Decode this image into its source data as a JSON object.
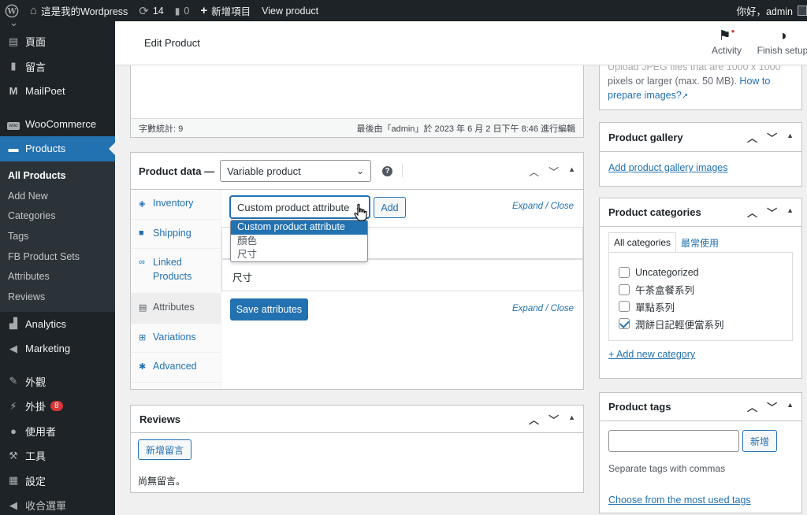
{
  "adminbar": {
    "site_name": "這是我的Wordpress",
    "updates_count": "14",
    "comments_count": "0",
    "new_label": "新增項目",
    "view_label": "View product",
    "greeting": "你好，admin"
  },
  "sidebar": {
    "items_top": [
      {
        "icon": "page-icon",
        "label": "頁面"
      },
      {
        "icon": "comment-icon",
        "label": "留言"
      },
      {
        "icon": "mailpoet-icon",
        "label": "MailPoet"
      },
      {
        "icon": "woo-icon",
        "label": "WooCommerce"
      }
    ],
    "products_label": "Products",
    "submenu": [
      "All Products",
      "Add New",
      "Categories",
      "Tags",
      "FB Product Sets",
      "Attributes",
      "Reviews"
    ],
    "items_bottom": [
      {
        "icon": "analytics-icon",
        "label": "Analytics"
      },
      {
        "icon": "marketing-icon",
        "label": "Marketing"
      },
      {
        "icon": "appearance-icon",
        "label": "外觀"
      },
      {
        "icon": "plugins-icon",
        "label": "外掛"
      },
      {
        "icon": "users-icon",
        "label": "使用者"
      },
      {
        "icon": "tools-icon",
        "label": "工具"
      },
      {
        "icon": "settings-icon",
        "label": "設定"
      },
      {
        "icon": "collapse-icon",
        "label": "收合選單"
      }
    ],
    "plugins_badge": "8"
  },
  "header": {
    "title": "Edit Product",
    "activity_label": "Activity",
    "finish_setup_label": "Finish setup"
  },
  "editor": {
    "word_count": "字數統計: 9",
    "last_edited": "最後由「admin」於 2023 年 6 月 2 日下午 8:46 進行編輯"
  },
  "product_data": {
    "label": "Product data —",
    "type_value": "Variable product",
    "tabs": [
      "Inventory",
      "Shipping",
      "Linked Products",
      "Attributes",
      "Variations",
      "Advanced"
    ],
    "attribute_select_value": "Custom product attribute",
    "add_button": "Add",
    "expand_close": "Expand / Close",
    "dropdown_options": [
      "Custom product attribute",
      "顏色",
      "尺寸"
    ],
    "attribute_rows": [
      "",
      "尺寸"
    ],
    "save_attributes": "Save attributes"
  },
  "reviews": {
    "title": "Reviews",
    "add_button": "新增留言",
    "empty_text": "尚無留言。"
  },
  "product_image": {
    "hint": "Upload JPEG files that are 1000 x 1000 pixels or larger (max. 50 MB).",
    "hint_line1": "Upload JPEG files that are 1000 x 1000",
    "hint_line2": "pixels or larger (max. 50 MB).",
    "link_part1": "How to",
    "link_part2": "prepare images?"
  },
  "gallery": {
    "title": "Product gallery",
    "link": "Add product gallery images"
  },
  "categories": {
    "title": "Product categories",
    "tab_all": "All categories",
    "tab_common": "最常使用",
    "items": [
      {
        "label": "Uncategorized",
        "checked": false
      },
      {
        "label": "午茶盒餐系列",
        "checked": false
      },
      {
        "label": "單點系列",
        "checked": false
      },
      {
        "label": "潤餅日記輕便當系列",
        "checked": true
      }
    ],
    "add_new": "+ Add new category"
  },
  "tags": {
    "title": "Product tags",
    "add_button": "新增",
    "hint": "Separate tags with commas",
    "choose_link": "Choose from the most used tags"
  }
}
